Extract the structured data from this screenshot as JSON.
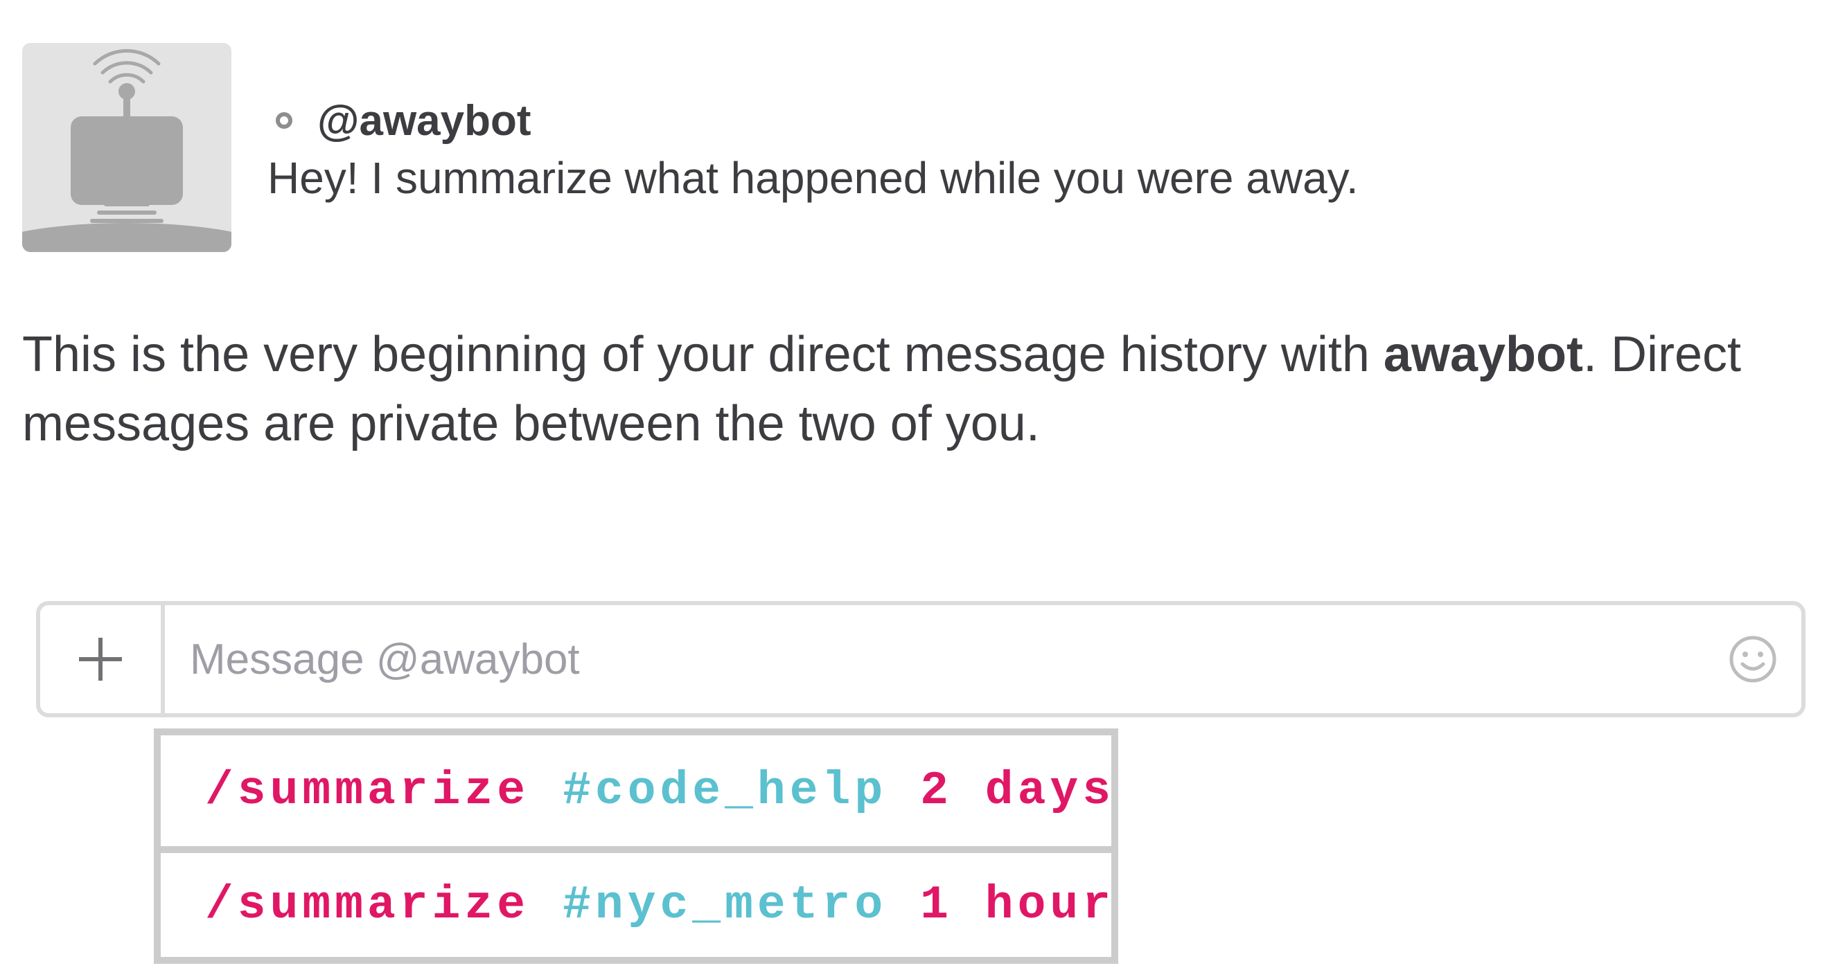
{
  "bot": {
    "handle": "@awaybot",
    "description": "Hey! I summarize what happened while you were away.",
    "avatar_icon": "robot-avatar-icon",
    "presence_icon": "away-presence-icon"
  },
  "intro": {
    "before": "This is the very beginning of your direct message history with ",
    "name": "awaybot",
    "after": ". Direct messages are private between the two of you."
  },
  "composer": {
    "placeholder": "Message @awaybot",
    "value": "",
    "add_icon": "plus-icon",
    "emoji_icon": "smiley-icon"
  },
  "suggestions": [
    {
      "command": "/summarize",
      "channel": "#code_help",
      "duration": "2 days"
    },
    {
      "command": "/summarize",
      "channel": "#nyc_metro",
      "duration": "1 hour"
    }
  ],
  "colors": {
    "command": "#e01765",
    "channel": "#5bc0cf",
    "text": "#3d3c40",
    "border": "#dcdcdc"
  }
}
